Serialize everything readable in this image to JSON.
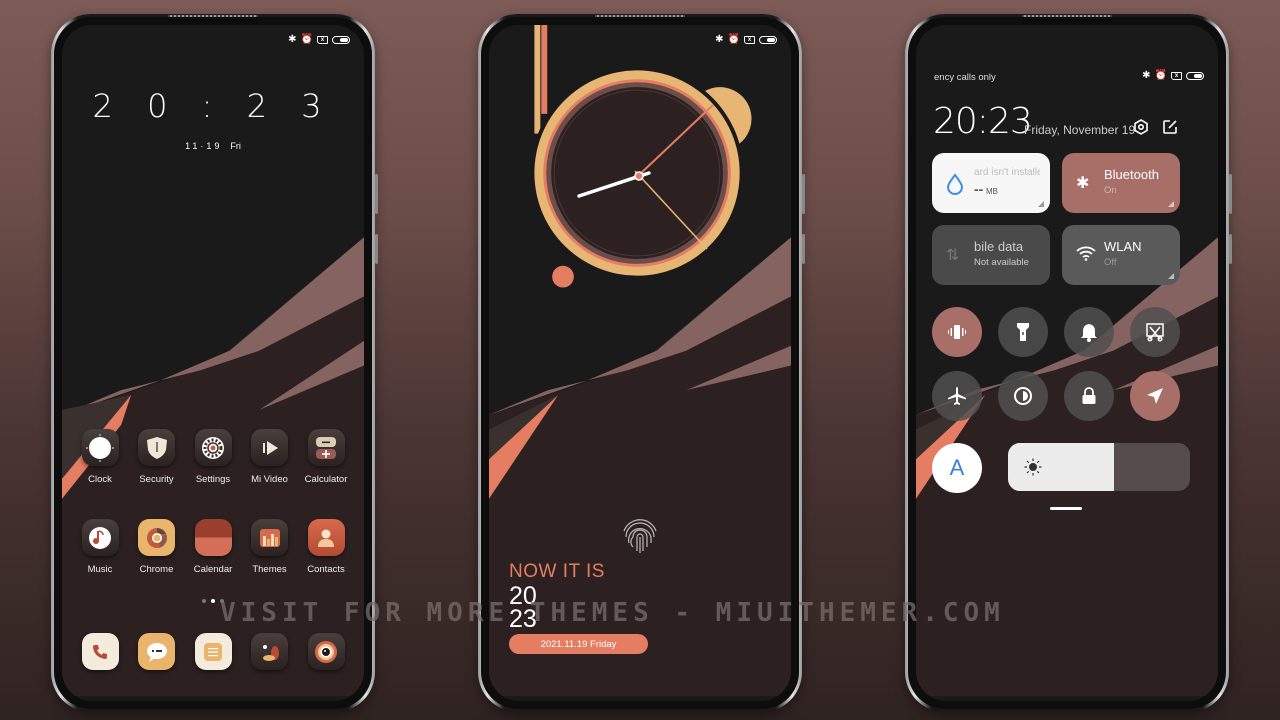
{
  "colors": {
    "accent_coral": "#e57d63",
    "accent_gold": "#e7b674",
    "rose": "#a86e68",
    "bg_dark": "#1b1a1a",
    "bg_brown": "#2c2120"
  },
  "status_bar": {
    "icons": [
      "bluetooth-icon",
      "alarm-icon",
      "no-sim-icon",
      "battery-icon"
    ]
  },
  "home_screen": {
    "time": "20:23",
    "time_h": "2 0",
    "time_m": "2 3",
    "date": "11·19",
    "day": "Fri",
    "row1": [
      {
        "label": "Clock",
        "icon": "clock-icon"
      },
      {
        "label": "Security",
        "icon": "shield-icon"
      },
      {
        "label": "Settings",
        "icon": "gear-icon"
      },
      {
        "label": "Mi Video",
        "icon": "play-icon"
      },
      {
        "label": "Calculator",
        "icon": "calculator-icon"
      }
    ],
    "row2": [
      {
        "label": "Music",
        "icon": "music-icon"
      },
      {
        "label": "Chrome",
        "icon": "chrome-icon"
      },
      {
        "label": "Calendar",
        "icon": "calendar-icon"
      },
      {
        "label": "Themes",
        "icon": "themes-icon"
      },
      {
        "label": "Contacts",
        "icon": "contact-icon"
      }
    ],
    "dock": [
      {
        "icon": "phone-icon"
      },
      {
        "icon": "messages-icon"
      },
      {
        "icon": "notes-icon"
      },
      {
        "icon": "gallery-icon"
      },
      {
        "icon": "camera-icon"
      }
    ],
    "page_count": 3,
    "active_page": 2
  },
  "lock_screen": {
    "analog_time": "20:23",
    "heading": "NOW IT IS",
    "hour": "20",
    "minute": "23",
    "date_pill": "2021.11.19  Friday"
  },
  "control_center": {
    "carrier_text": "ency calls only",
    "time": "20:23",
    "date": "Friday, November 19",
    "tiles": [
      {
        "title": "ard isn't installe",
        "sub_value": "--",
        "sub_unit": "MB",
        "icon": "water-drop-icon",
        "state": "light"
      },
      {
        "title": "Bluetooth",
        "sub": "On",
        "icon": "bluetooth-icon",
        "state": "on"
      },
      {
        "title": "bile data",
        "sub": "Not available",
        "icon": "mobile-data-icon",
        "state": "disabled"
      },
      {
        "title": "WLAN",
        "sub": "Off",
        "icon": "wifi-icon",
        "state": "off"
      }
    ],
    "toggles": [
      {
        "name": "vibrate",
        "icon": "vibrate-icon",
        "on": true
      },
      {
        "name": "flashlight",
        "icon": "flashlight-icon",
        "on": false
      },
      {
        "name": "mute",
        "icon": "bell-icon",
        "on": false
      },
      {
        "name": "screenshot",
        "icon": "screenshot-icon",
        "on": false
      },
      {
        "name": "airplane",
        "icon": "airplane-icon",
        "on": false
      },
      {
        "name": "reading-mode",
        "icon": "contrast-icon",
        "on": false
      },
      {
        "name": "lock-screen",
        "icon": "lock-icon",
        "on": false
      },
      {
        "name": "location",
        "icon": "location-icon",
        "on": true
      }
    ],
    "auto_brightness_label": "A",
    "brightness_percent": 58
  },
  "watermark": "VISIT FOR MORE THEMES - MIUITHEMER.COM"
}
